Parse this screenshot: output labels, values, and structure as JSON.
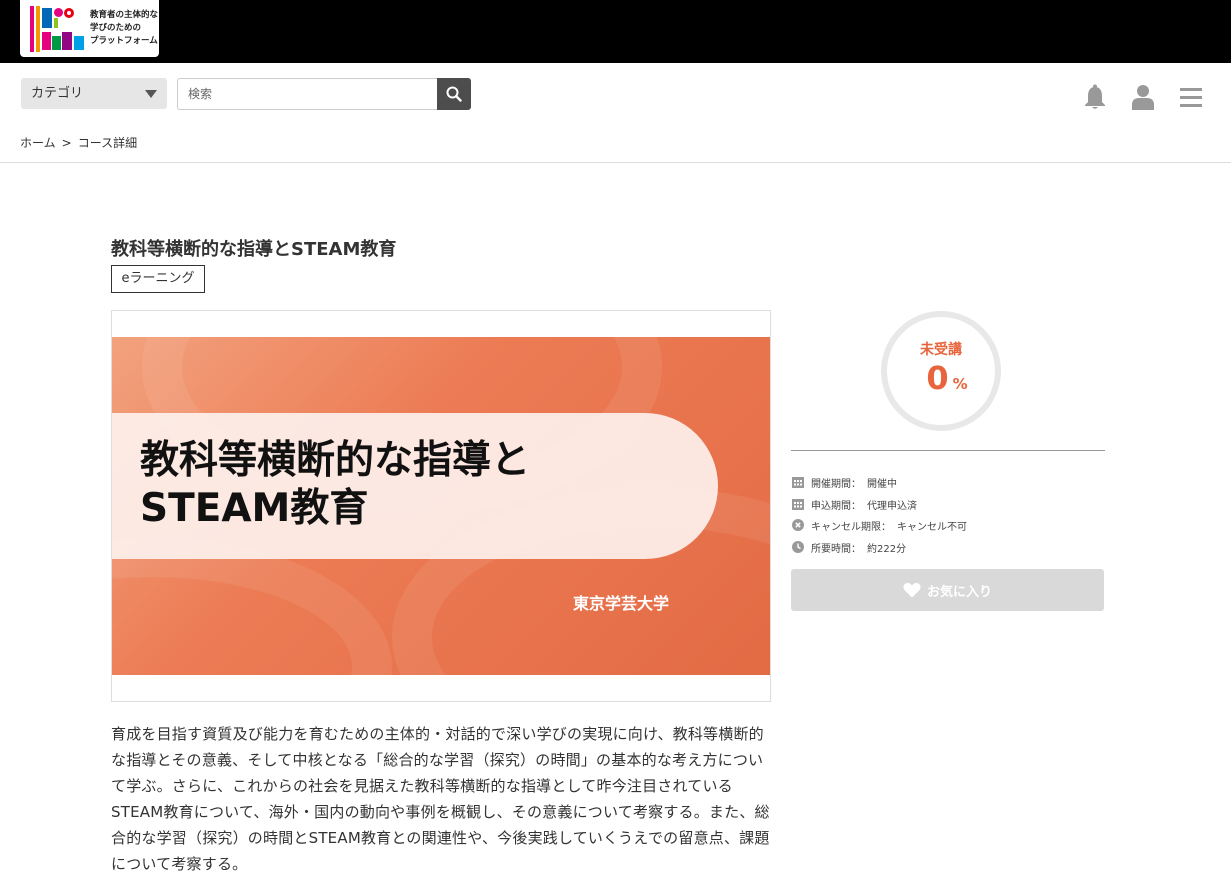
{
  "brand": {
    "logo_tagline_line1": "教育者の主体的な",
    "logo_tagline_line2": "学びのための",
    "logo_tagline_line3": "プラットフォーム",
    "colors": {
      "topbar": "#000000",
      "accent": "#e8643c"
    }
  },
  "header": {
    "category_label": "カテゴリ",
    "search_placeholder": "検索",
    "icons": [
      "search-icon",
      "bell-icon",
      "user-icon",
      "menu-icon"
    ]
  },
  "breadcrumb": {
    "home": "ホーム",
    "separator": ">",
    "current": "コース詳細"
  },
  "course": {
    "title": "教科等横断的な指導とSTEAM教育",
    "tag": "eラーニング",
    "thumbnail": {
      "title_line1": "教科等横断的な指導と",
      "title_line2": "STEAM教育",
      "university": "東京学芸大学"
    },
    "description": "育成を目指す資質及び能力を育むための主体的・対話的で深い学びの実現に向け、教科等横断的な指導とその意義、そして中核となる「総合的な学習（探究）の時間」の基本的な考え方について学ぶ。さらに、これからの社会を見据えた教科等横断的な指導として昨今注目されているSTEAM教育について、海外・国内の動向や事例を概観し、その意義について考察する。また、総合的な学習（探究）の時間とSTEAM教育との関連性や、今後実践していくうえでの留意点、課題について考察する。"
  },
  "progress": {
    "status": "未受講",
    "percent": "0",
    "unit": "%"
  },
  "info": [
    {
      "icon": "calendar-icon",
      "label": "開催期間：",
      "value": "開催中"
    },
    {
      "icon": "calendar-icon",
      "label": "申込期間：",
      "value": "代理申込済"
    },
    {
      "icon": "cancel-icon",
      "label": "キャンセル期限：",
      "value": "キャンセル不可"
    },
    {
      "icon": "clock-icon",
      "label": "所要時間：",
      "value": "約222分"
    }
  ],
  "favorite_button": {
    "label": "お気に入り",
    "icon": "heart-icon"
  }
}
